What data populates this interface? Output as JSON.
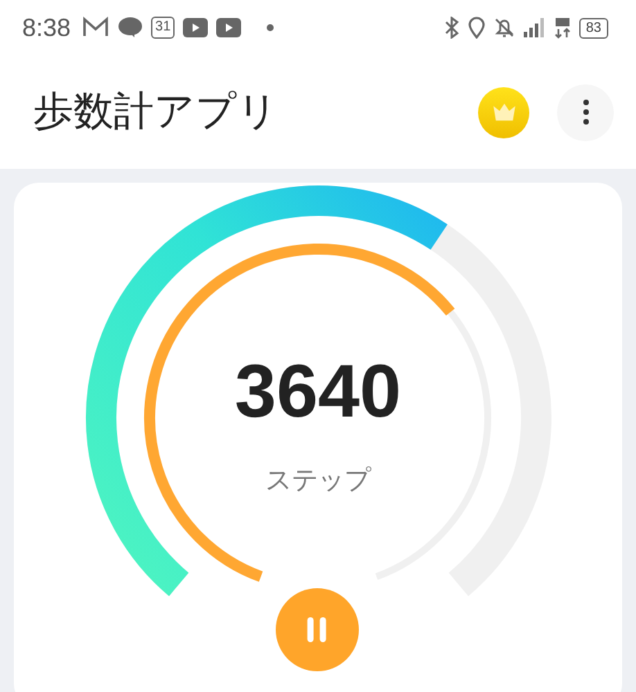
{
  "status_bar": {
    "time": "8:38",
    "calendar_day": "31",
    "battery": "83"
  },
  "app_bar": {
    "title": "歩数計アプリ"
  },
  "tracker": {
    "steps": "3640",
    "unit": "ステップ",
    "paused": false
  }
}
